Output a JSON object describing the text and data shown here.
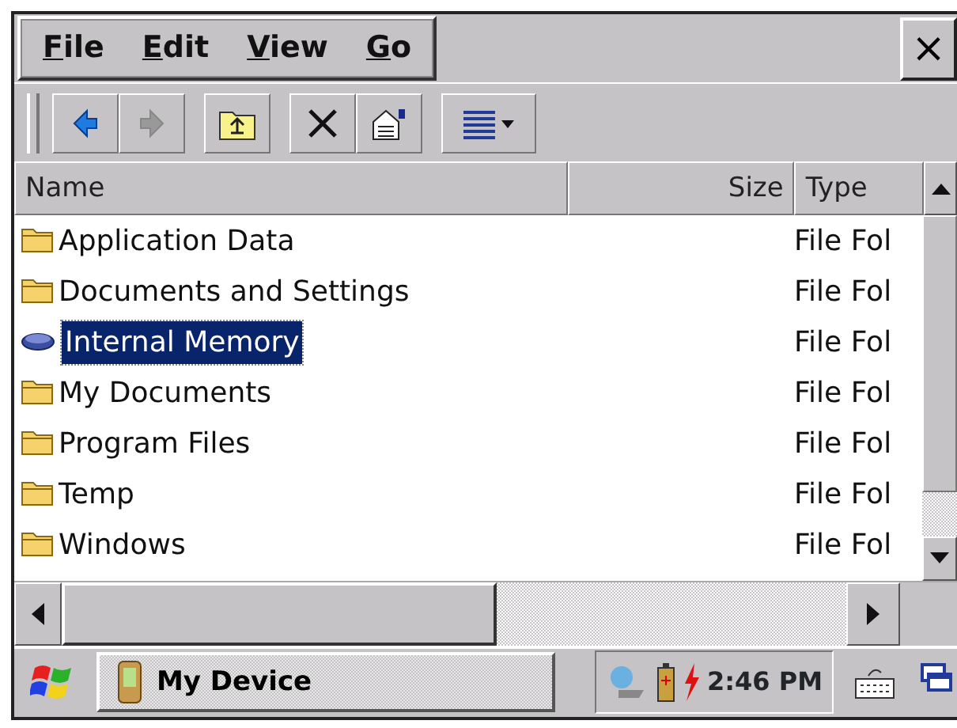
{
  "menu": [
    {
      "label": "File"
    },
    {
      "label": "Edit"
    },
    {
      "label": "View"
    },
    {
      "label": "Go"
    }
  ],
  "close_button": "×",
  "toolbar": [
    {
      "kind": "back",
      "disabled": false
    },
    {
      "kind": "forward",
      "disabled": true
    },
    {
      "kind": "up",
      "disabled": false
    },
    {
      "kind": "delete",
      "disabled": false
    },
    {
      "kind": "properties",
      "disabled": false
    },
    {
      "kind": "view",
      "disabled": false
    }
  ],
  "columns": [
    "Name",
    "Size",
    "Type"
  ],
  "rows": [
    {
      "kind": "folder",
      "name": "Application Data",
      "type": "File Fol",
      "selected": false
    },
    {
      "kind": "folder",
      "name": "Documents and Settings",
      "type": "File Fol",
      "selected": false
    },
    {
      "kind": "storage",
      "name": "Internal Memory",
      "type": "File Fol",
      "selected": true
    },
    {
      "kind": "folder",
      "name": "My Documents",
      "type": "File Fol",
      "selected": false
    },
    {
      "kind": "folder",
      "name": "Program Files",
      "type": "File Fol",
      "selected": false
    },
    {
      "kind": "folder",
      "name": "Temp",
      "type": "File Fol",
      "selected": false
    },
    {
      "kind": "folder",
      "name": "Windows",
      "type": "File Fol",
      "selected": false
    }
  ],
  "taskbar": {
    "task": "My Device",
    "time": "2:46 PM"
  }
}
